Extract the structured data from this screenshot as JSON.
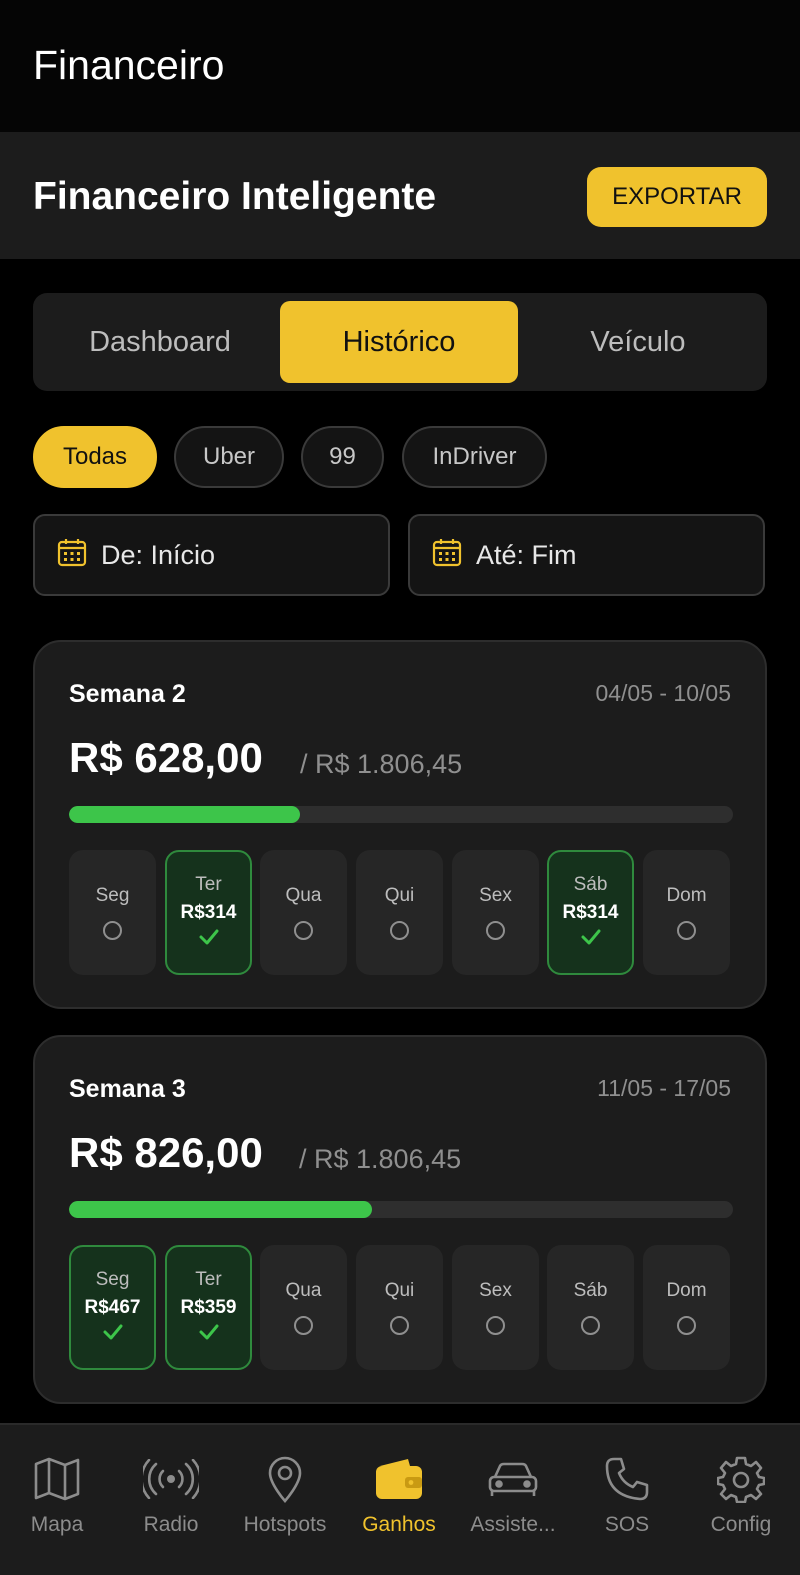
{
  "appbar": {
    "title": "Financeiro"
  },
  "header": {
    "title": "Financeiro Inteligente",
    "export_label": "EXPORTAR"
  },
  "tabs": [
    {
      "label": "Dashboard",
      "active": false
    },
    {
      "label": "Histórico",
      "active": true
    },
    {
      "label": "Veículo",
      "active": false
    }
  ],
  "filters": [
    {
      "label": "Todas",
      "active": true
    },
    {
      "label": "Uber",
      "active": false
    },
    {
      "label": "99",
      "active": false
    },
    {
      "label": "InDriver",
      "active": false
    }
  ],
  "date_range": {
    "from": "De: Início",
    "to": "Até: Fim",
    "icon": "calendar-icon"
  },
  "weeks": [
    {
      "name": "Semana 2",
      "range": "04/05 - 10/05",
      "amount": "R$ 628,00",
      "goal": "/ R$ 1.806,45",
      "progress": 0.348,
      "days": [
        {
          "label": "Seg",
          "value": null,
          "done": false
        },
        {
          "label": "Ter",
          "value": "R$314",
          "done": true
        },
        {
          "label": "Qua",
          "value": null,
          "done": false
        },
        {
          "label": "Qui",
          "value": null,
          "done": false
        },
        {
          "label": "Sex",
          "value": null,
          "done": false
        },
        {
          "label": "Sáb",
          "value": "R$314",
          "done": true
        },
        {
          "label": "Dom",
          "value": null,
          "done": false
        }
      ]
    },
    {
      "name": "Semana 3",
      "range": "11/05 - 17/05",
      "amount": "R$ 826,00",
      "goal": "/ R$ 1.806,45",
      "progress": 0.457,
      "days": [
        {
          "label": "Seg",
          "value": "R$467",
          "done": true
        },
        {
          "label": "Ter",
          "value": "R$359",
          "done": true
        },
        {
          "label": "Qua",
          "value": null,
          "done": false
        },
        {
          "label": "Qui",
          "value": null,
          "done": false
        },
        {
          "label": "Sex",
          "value": null,
          "done": false
        },
        {
          "label": "Sáb",
          "value": null,
          "done": false
        },
        {
          "label": "Dom",
          "value": null,
          "done": false
        }
      ]
    }
  ],
  "colors": {
    "accent": "#f0c22d",
    "success": "#3dc54a",
    "background": "#000000",
    "card": "#1c1c1c"
  },
  "bottom_nav": [
    {
      "label": "Mapa",
      "icon": "map-icon",
      "active": false
    },
    {
      "label": "Radio",
      "icon": "radio-icon",
      "active": false
    },
    {
      "label": "Hotspots",
      "icon": "location-pin-icon",
      "active": false
    },
    {
      "label": "Ganhos",
      "icon": "wallet-icon",
      "active": true
    },
    {
      "label": "Assiste...",
      "icon": "car-icon",
      "active": false
    },
    {
      "label": "SOS",
      "icon": "phone-icon",
      "active": false
    },
    {
      "label": "Config",
      "icon": "gear-icon",
      "active": false
    }
  ]
}
